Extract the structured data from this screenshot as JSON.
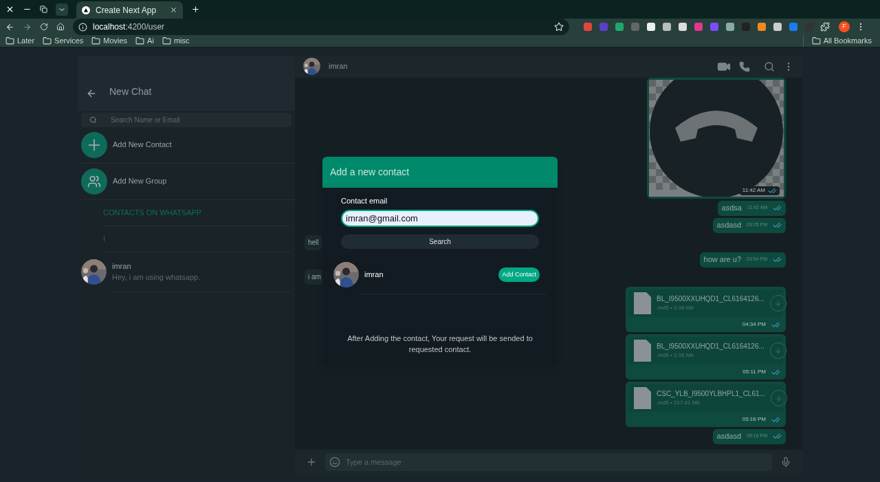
{
  "browser": {
    "tab": {
      "title": "Create Next App",
      "selected": true
    },
    "url_host": "localhost",
    "url_path": ":4200/user",
    "bookmarks": [
      "Later",
      "Services",
      "Movies",
      "Ai",
      "misc"
    ],
    "all_bookmarks": "All Bookmarks",
    "profile_initial": "F"
  },
  "sidebar": {
    "title": "New Chat",
    "search_placeholder": "Search Name or Email",
    "actions": [
      {
        "kind": "contact",
        "label": "Add New Contact"
      },
      {
        "kind": "group",
        "label": "Add New Group"
      }
    ],
    "section_heading": "CONTACTS ON WHATSAPP",
    "letter": "I",
    "contacts": [
      {
        "name": "imran",
        "status": "Hey, i am using whatsapp."
      }
    ]
  },
  "chat": {
    "contact_name": "imran",
    "input_placeholder": "Type a message",
    "messages": [
      {
        "outgoing": true,
        "time": "11:42 AM"
      },
      {
        "kind": "text",
        "outgoing": true,
        "text": "asdsa",
        "time": "11:42 AM"
      },
      {
        "kind": "text",
        "outgoing": true,
        "text": "asdasd",
        "time": "03:05 PM"
      },
      {
        "kind": "text",
        "outgoing": false,
        "text": "hell"
      },
      {
        "kind": "text",
        "outgoing": true,
        "text": "how are u?",
        "time": "03:54 PM"
      },
      {
        "kind": "text",
        "outgoing": false,
        "text": "i am"
      },
      {
        "kind": "file",
        "outgoing": true,
        "file_name": "BL_I9500XXUHQD1_CL6164126...",
        "file_info": ".md5 • 2.06 Mb",
        "time": "04:34 PM"
      },
      {
        "kind": "file",
        "outgoing": true,
        "file_name": "BL_I9500XXUHQD1_CL6164126...",
        "file_info": ".md5 • 2.06 Mb",
        "time": "05:11 PM"
      },
      {
        "kind": "file",
        "outgoing": true,
        "file_name": "CSC_YLB_I9500YLBHPL1_CL61...",
        "file_info": ".md5 • 217.81 Mb",
        "time": "05:16 PM"
      },
      {
        "kind": "text",
        "outgoing": true,
        "text": "asdasd",
        "time": "05:16 PM"
      }
    ]
  },
  "modal": {
    "title": "Add a new contact",
    "email_label": "Contact email",
    "email_value": "imran@gmail.com",
    "search_button": "Search",
    "results": [
      {
        "name": "imran",
        "button": "Add Contact"
      }
    ],
    "note": "After Adding the contact, Your request will be sended to requested contact."
  }
}
